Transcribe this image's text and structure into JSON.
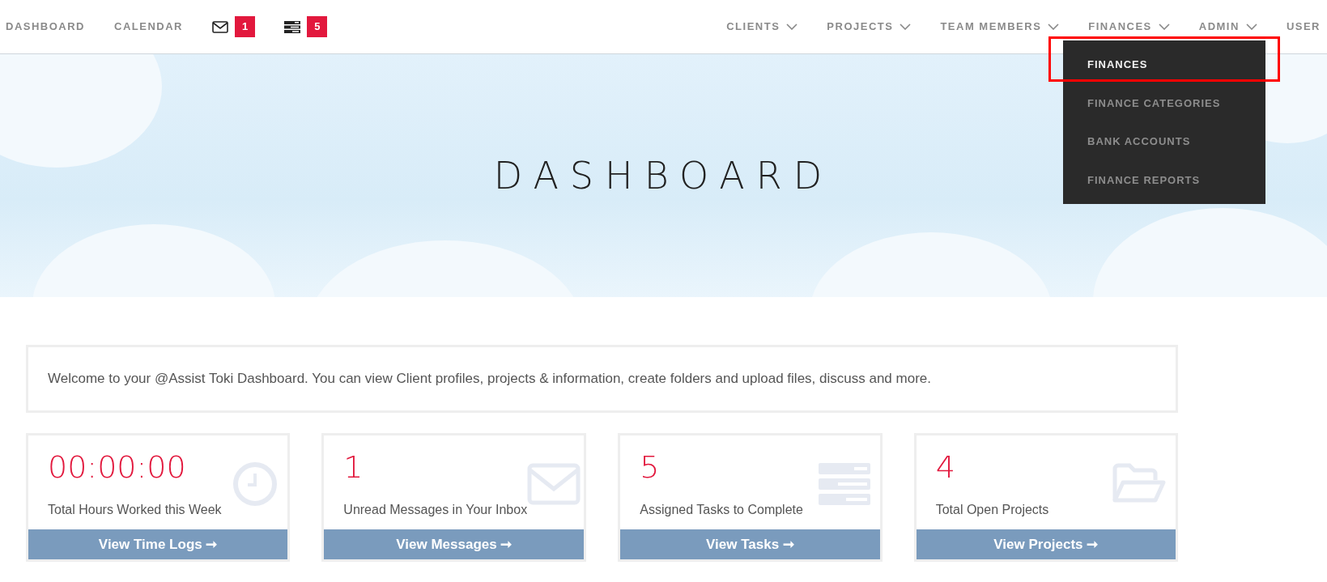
{
  "nav_left": [
    {
      "kind": "link",
      "label": "DASHBOARD"
    },
    {
      "kind": "link",
      "label": "CALENDAR"
    },
    {
      "kind": "icon-badge",
      "badge": "1"
    },
    {
      "kind": "icon-badge",
      "badge": "5"
    }
  ],
  "nav_right": [
    {
      "label": "CLIENTS",
      "has_dropdown": true
    },
    {
      "label": "PROJECTS",
      "has_dropdown": true
    },
    {
      "label": "TEAM MEMBERS",
      "has_dropdown": true
    },
    {
      "label": "FINANCES",
      "has_dropdown": true
    },
    {
      "label": "ADMIN",
      "has_dropdown": true
    },
    {
      "label": "USER",
      "has_dropdown": false
    }
  ],
  "dropdown": {
    "items": [
      {
        "label": "FINANCES",
        "selected": true,
        "highlighted": true
      },
      {
        "label": "FINANCE CATEGORIES",
        "selected": false,
        "highlighted": false
      },
      {
        "label": "BANK ACCOUNTS",
        "selected": false,
        "highlighted": false
      },
      {
        "label": "FINANCE REPORTS",
        "selected": false,
        "highlighted": false
      }
    ]
  },
  "hero": {
    "title": "DASHBOARD"
  },
  "welcome": "Welcome to your @Assist Toki Dashboard. You can view Client profiles, projects & information, create folders and upload files, discuss and more.",
  "stat_cards": [
    {
      "value": "00:00:00",
      "label": "Total Hours Worked this Week",
      "link": "View Time Logs ➞"
    },
    {
      "value": "1",
      "label": "Unread Messages in Your Inbox",
      "link": "View Messages ➞"
    },
    {
      "value": "5",
      "label": "Assigned Tasks to Complete",
      "link": "View Tasks ➞"
    },
    {
      "value": "4",
      "label": "Total Open Projects",
      "link": "View Projects ➞"
    }
  ]
}
